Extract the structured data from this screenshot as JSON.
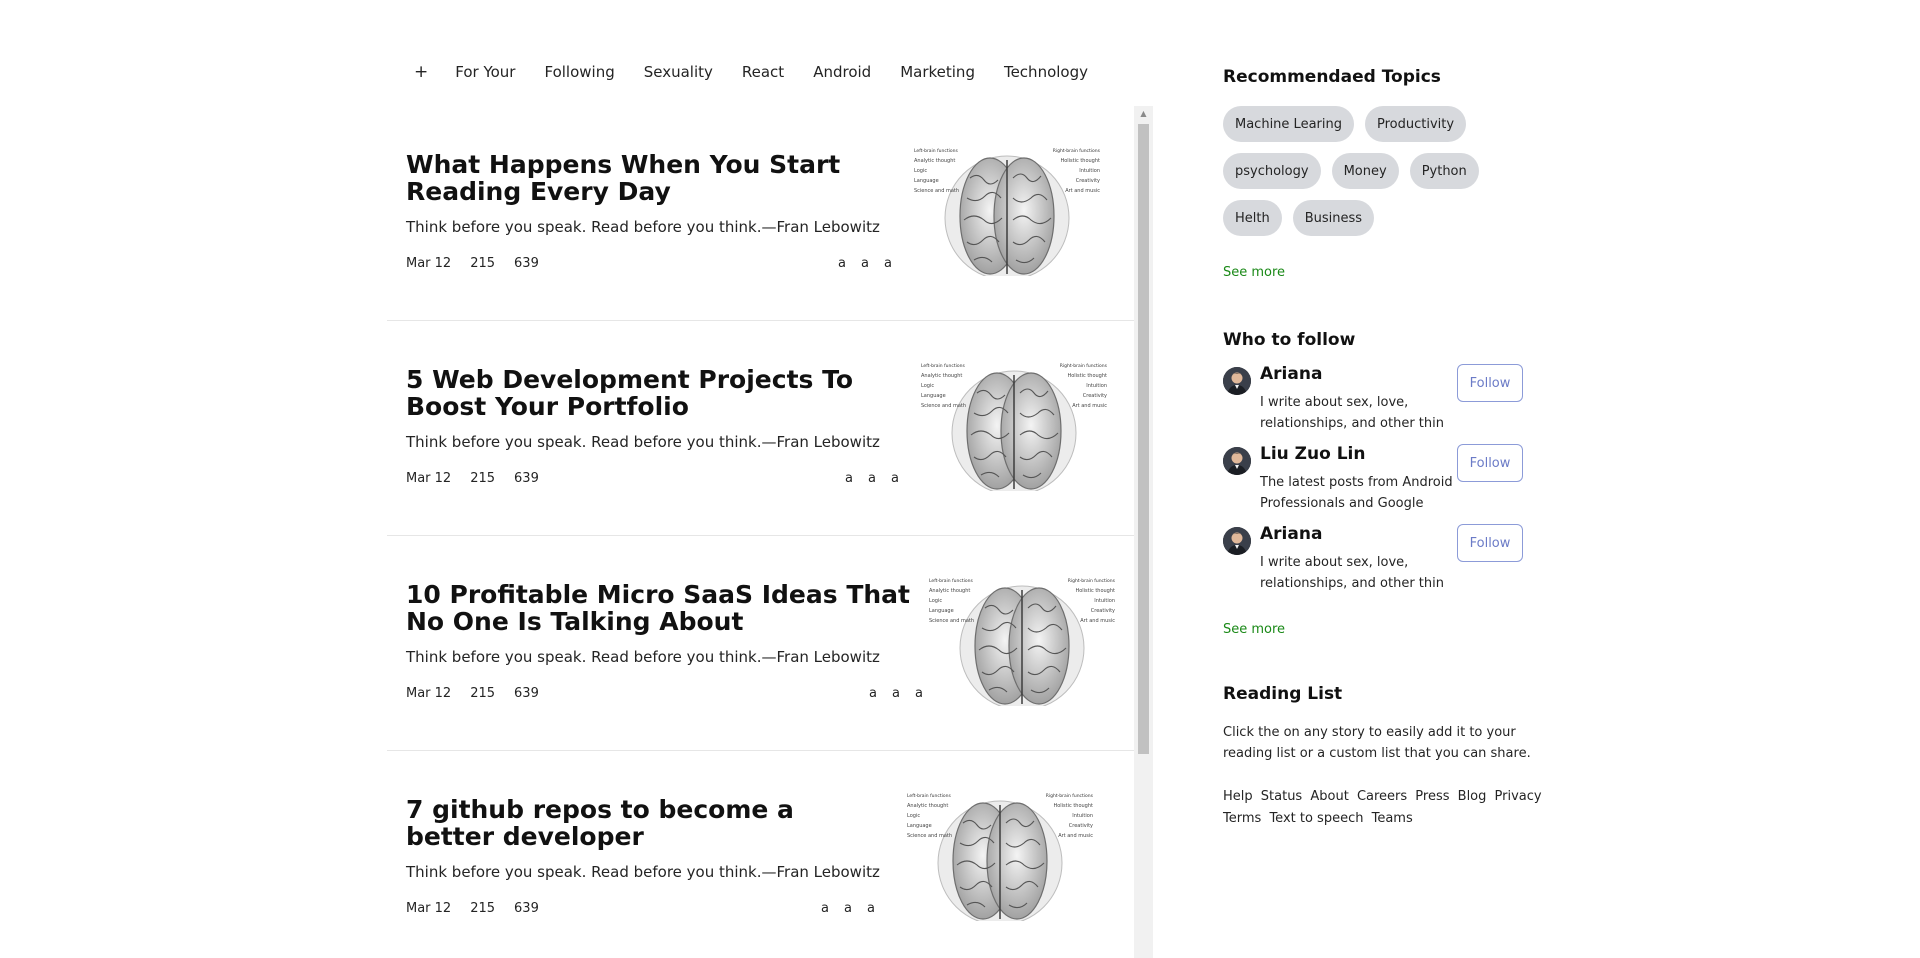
{
  "nav": {
    "plus": "+",
    "tabs": [
      "For Your",
      "Following",
      "Sexuality",
      "React",
      "Android",
      "Marketing",
      "Technology"
    ]
  },
  "articles": [
    {
      "title": "What Happens When You Start Reading Every Day",
      "subtitle": "Think before you speak. Read before you think.—Fran Lebowitz",
      "date": "Mar 12",
      "claps": "215",
      "responses": "639",
      "actions": [
        "a",
        "a",
        "a"
      ]
    },
    {
      "title": "5 Web Development Projects To Boost Your Portfolio",
      "subtitle": "Think before you speak. Read before you think.—Fran Lebowitz",
      "date": "Mar 12",
      "claps": "215",
      "responses": "639",
      "actions": [
        "a",
        "a",
        "a"
      ]
    },
    {
      "title": "10 Profitable Micro SaaS Ideas That No One Is Talking About",
      "subtitle": "Think before you speak. Read before you think.—Fran Lebowitz",
      "date": "Mar 12",
      "claps": "215",
      "responses": "639",
      "actions": [
        "a",
        "a",
        "a"
      ]
    },
    {
      "title": "7 github repos to become a better developer",
      "subtitle": "Think before you speak. Read before you think.—Fran Lebowitz",
      "date": "Mar 12",
      "claps": "215",
      "responses": "639",
      "actions": [
        "a",
        "a",
        "a"
      ]
    }
  ],
  "sidebar": {
    "topics_title": "Recommendaed Topics",
    "topics": [
      "Machine Learing",
      "Productivity",
      "psychology",
      "Money",
      "Python",
      "Helth",
      "Business"
    ],
    "see_more": "See more",
    "follow_title": "Who to follow",
    "people": [
      {
        "name": "Ariana",
        "bio": "I write about sex, love, relationships, and other thin",
        "button": "Follow"
      },
      {
        "name": "Liu Zuo Lin",
        "bio": "The latest posts from Android Professionals and Google",
        "button": "Follow"
      },
      {
        "name": "Ariana",
        "bio": "I write about sex, love, relationships, and other thin",
        "button": "Follow"
      }
    ],
    "see_more_people": "See more",
    "reading_title": "Reading List",
    "reading_text": "Click the on any story to easily add it to your reading list or a custom list that you can share.",
    "footer_links": [
      "Help",
      "Status",
      "About",
      "Careers",
      "Press",
      "Blog",
      "Privacy",
      "Terms",
      "Text to speech",
      "Teams"
    ]
  },
  "brain_labels": {
    "left_header": "Left-brain functions",
    "right_header": "Right-brain functions",
    "left": [
      "Analytic thought",
      "Logic",
      "Language",
      "Science and math"
    ],
    "right": [
      "Holistic thought",
      "Intuition",
      "Creativity",
      "Art and music"
    ]
  }
}
